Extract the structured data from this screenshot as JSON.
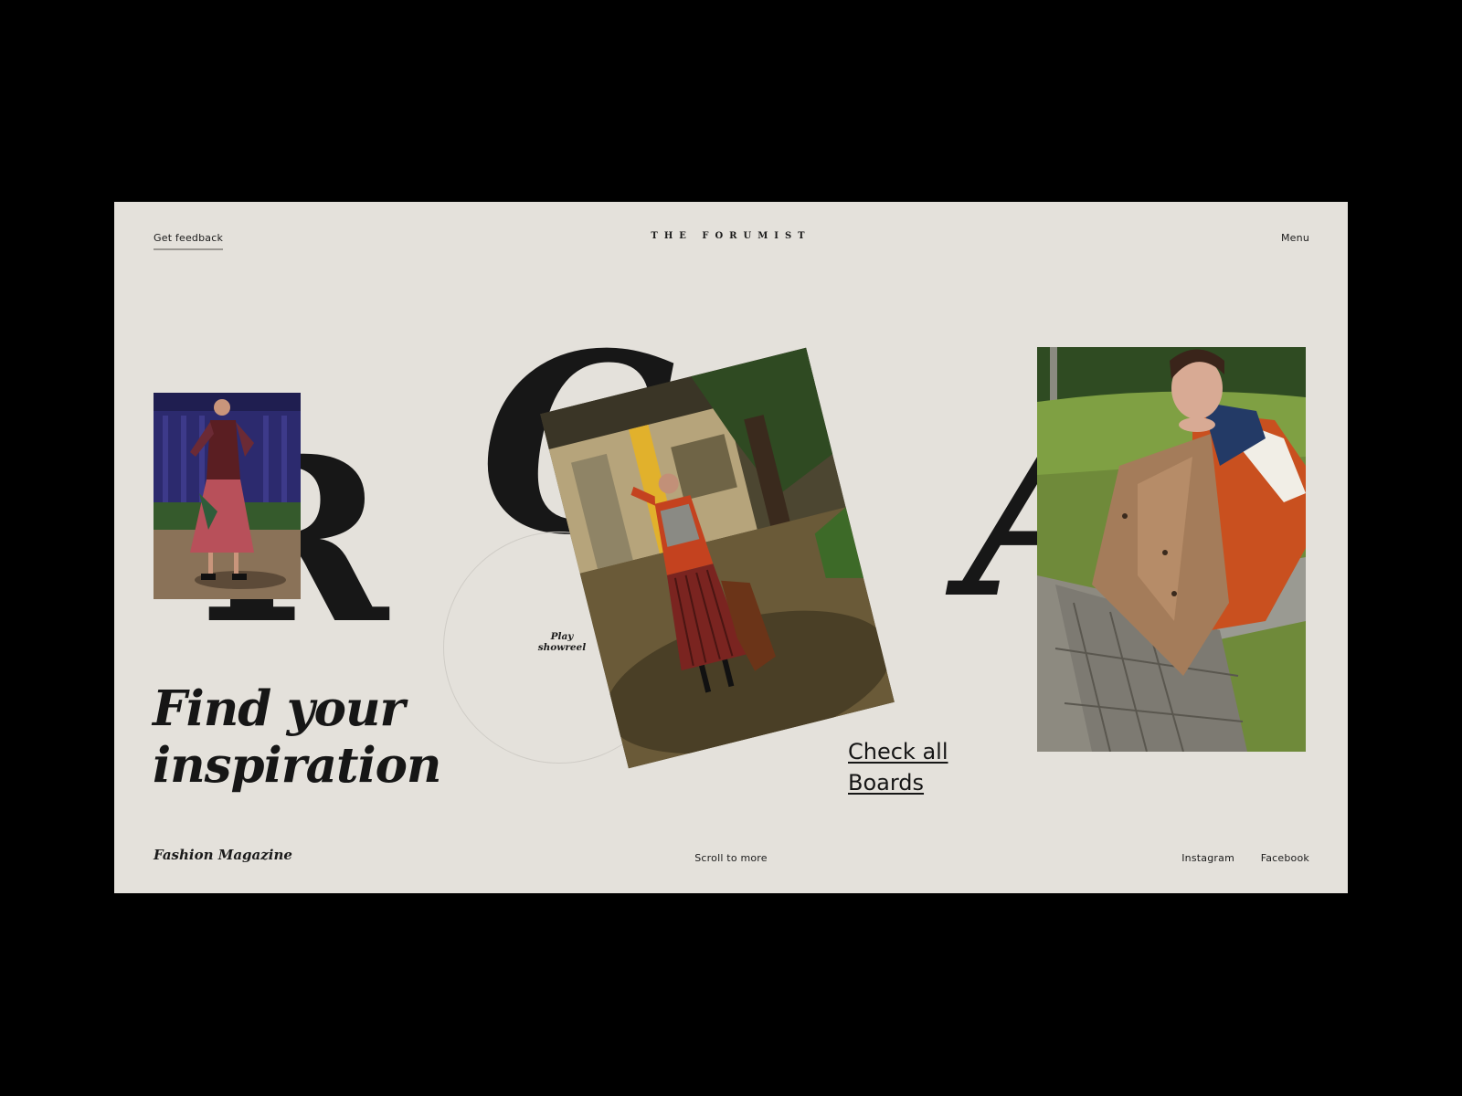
{
  "header": {
    "feedback_label": "Get feedback",
    "brand": "THE FORUMIST",
    "menu_label": "Menu"
  },
  "hero": {
    "letters": [
      "R",
      "C",
      "A"
    ],
    "play_label_line1": "Play",
    "play_label_line2": "showreel",
    "headline_line1": "Find your",
    "headline_line2": "inspiration",
    "cta_line1": "Check all",
    "cta_line2": "Boards"
  },
  "footer": {
    "brand": "Fashion Magazine",
    "scroll_label": "Scroll to more",
    "social": [
      "Instagram",
      "Facebook"
    ]
  },
  "colors": {
    "background": "#e4e1db",
    "ink": "#171717",
    "outer": "#000000"
  }
}
